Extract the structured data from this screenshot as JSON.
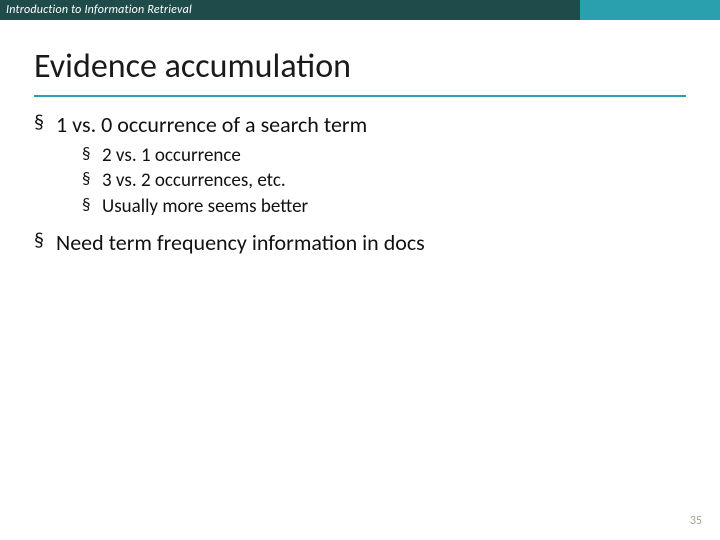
{
  "header": {
    "course": "Introduction to Information Retrieval"
  },
  "title": "Evidence accumulation",
  "bullets": [
    {
      "text": "1 vs. 0 occurrence of a search term",
      "children": [
        {
          "text": "2 vs. 1 occurrence"
        },
        {
          "text": "3 vs. 2 occurrences, etc."
        },
        {
          "text": "Usually more seems better"
        }
      ]
    },
    {
      "text": "Need term frequency information in docs",
      "children": []
    }
  ],
  "page_number": "35"
}
